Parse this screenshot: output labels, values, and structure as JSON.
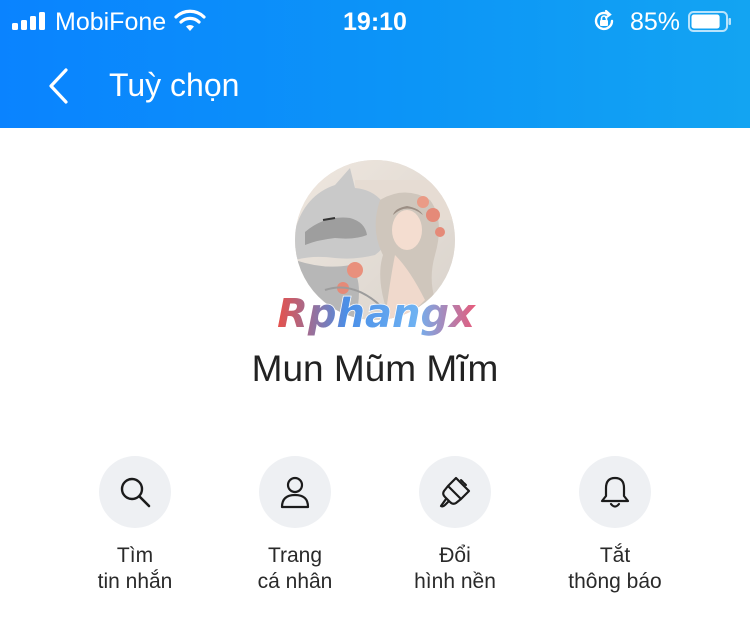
{
  "status_bar": {
    "carrier": "MobiFone",
    "time": "19:10",
    "battery": "85%",
    "battery_level": 0.85
  },
  "header": {
    "title": "Tuỳ chọn",
    "back_icon": "chevron-left-icon"
  },
  "profile": {
    "name": "Mun Mũm Mĩm",
    "watermark": "Rphangx"
  },
  "actions": [
    {
      "icon": "search-icon",
      "line1": "Tìm",
      "line2": "tin nhắn"
    },
    {
      "icon": "person-icon",
      "line1": "Trang",
      "line2": "cá nhân"
    },
    {
      "icon": "paintbrush-icon",
      "line1": "Đổi",
      "line2": "hình nền"
    },
    {
      "icon": "bell-icon",
      "line1": "Tắt",
      "line2": "thông báo"
    }
  ],
  "colors": {
    "header_start": "#0a83ff",
    "header_end": "#13a4f2",
    "action_bg": "#eef0f3",
    "icon_stroke": "#1b1b1b"
  }
}
